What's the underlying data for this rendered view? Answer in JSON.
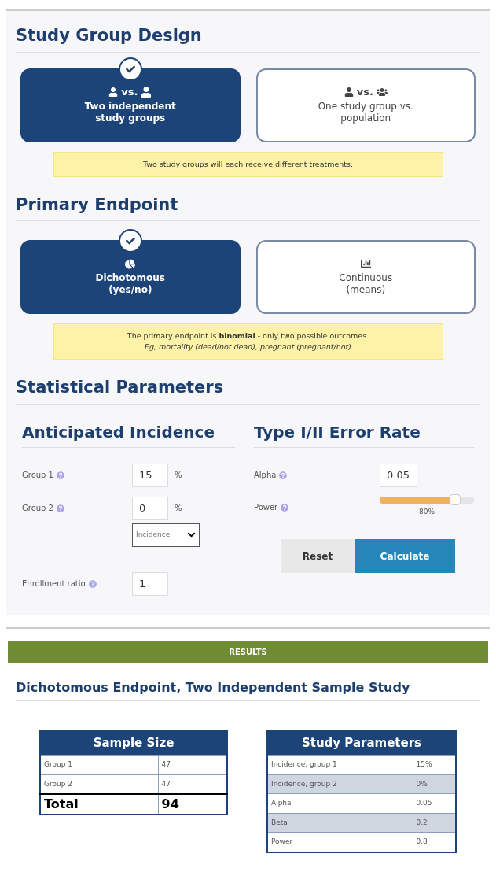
{
  "design": {
    "title": "Study Group Design",
    "options": [
      {
        "kind": "two_groups",
        "vs": "vs.",
        "label": "Two independent study groups",
        "selected": true
      },
      {
        "kind": "group_vs_population",
        "vs": "vs.",
        "label": "One study group vs. population",
        "selected": false
      }
    ],
    "note": {
      "text": "Two study groups will each receive different treatments."
    }
  },
  "endpoint": {
    "title": "Primary Endpoint",
    "options": [
      {
        "kind": "dichotomous",
        "label": "Dichotomous (yes/no)",
        "selected": true
      },
      {
        "kind": "continuous",
        "label": "Continuous (means)",
        "selected": false
      }
    ],
    "note": {
      "text": "The primary endpoint is **binomial** - only two possible outcomes.",
      "example": "Eg, mortality (dead/not dead), pregnant (pregnant/not)"
    }
  },
  "statistical": {
    "title": "Statistical Parameters",
    "incidence": {
      "title": "Anticipated Incidence",
      "group1": {
        "label": "Group 1",
        "value": "15",
        "unit": "%"
      },
      "group2": {
        "label": "Group 2",
        "value": "0",
        "unit": "%"
      },
      "select": {
        "value": "Incidence"
      },
      "ratio": {
        "label": "Enrollment ratio",
        "value": "1"
      }
    },
    "error_rate": {
      "title": "Type I/II Error Rate",
      "alpha": {
        "label": "Alpha",
        "value": "0.05"
      },
      "power": {
        "label": "Power",
        "level": 0.8,
        "reading": "80%"
      }
    },
    "buttons": [
      "Reset",
      "Calculate"
    ]
  },
  "results": {
    "banner": "RESULTS",
    "title": "Dichotomous Endpoint, Two Independent Sample Study",
    "sample_size": {
      "title": "Sample Size",
      "rows": [
        {
          "kind": "normal",
          "label": "Group 1",
          "value": "47"
        },
        {
          "kind": "normal",
          "label": "Group 2",
          "value": "47"
        },
        {
          "kind": "total",
          "label": "Total",
          "value": "94"
        }
      ]
    },
    "parameters": {
      "title": "Study Parameters",
      "rows": [
        {
          "label": "Incidence, group 1",
          "value": "15%"
        },
        {
          "label": "Incidence, group 2",
          "value": "0%"
        },
        {
          "label": "Alpha",
          "value": "0.05"
        },
        {
          "label": "Beta",
          "value": "0.2"
        },
        {
          "label": "Power",
          "value": "0.8"
        }
      ]
    }
  }
}
